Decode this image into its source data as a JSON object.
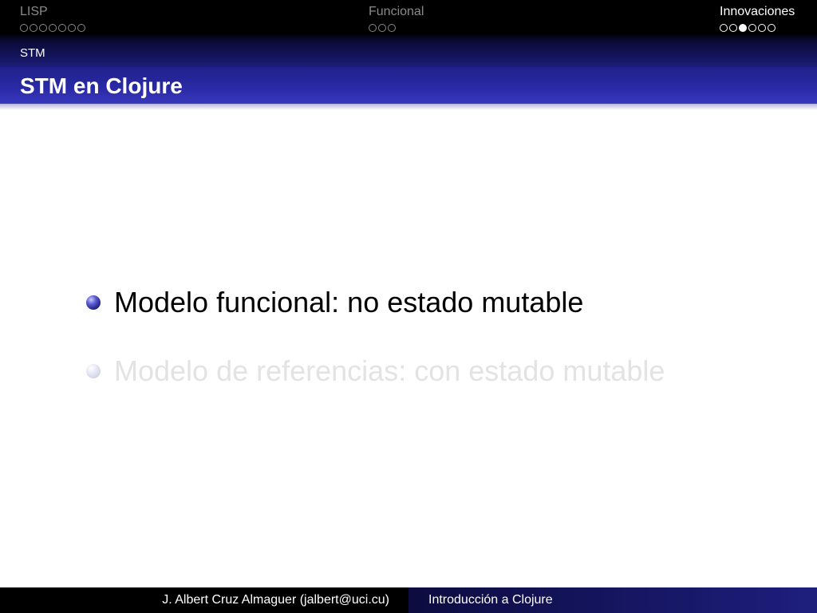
{
  "navigation": {
    "sections": [
      {
        "label": "LISP",
        "dots": 7,
        "current_dot": -1,
        "active": false
      },
      {
        "label": "Funcional",
        "dots": 3,
        "current_dot": -1,
        "active": false
      },
      {
        "label": "Innovaciones",
        "dots": 6,
        "current_dot": 2,
        "active": true
      }
    ]
  },
  "subsection": "STM",
  "frame": {
    "title": "STM en Clojure",
    "bullets": [
      {
        "text": "Modelo funcional: no estado mutable",
        "faded": false
      },
      {
        "text": "Modelo de referencias: con estado mutable",
        "faded": true
      }
    ]
  },
  "footer": {
    "author": "J. Albert Cruz Almaguer (jalbert@uci.cu)",
    "title": "Introducción a Clojure"
  },
  "colors": {
    "nav_bg": "#000000",
    "title_bg": "#2a2aa8",
    "bullet": "#1e1e80",
    "faded_text": "#e3e3e3"
  }
}
